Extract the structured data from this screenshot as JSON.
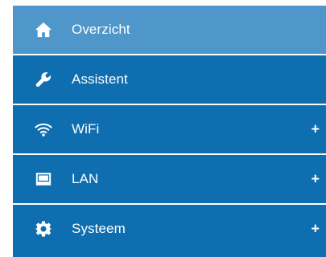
{
  "colors": {
    "item_bg": "#0f6eb0",
    "active_bg": "#4f96cb",
    "text": "#ffffff"
  },
  "menu": {
    "items": [
      {
        "label": "Overzicht",
        "icon": "home-icon",
        "active": true,
        "expandable": false
      },
      {
        "label": "Assistent",
        "icon": "wrench-icon",
        "active": false,
        "expandable": false
      },
      {
        "label": "WiFi",
        "icon": "wifi-icon",
        "active": false,
        "expandable": true,
        "expand_symbol": "+"
      },
      {
        "label": "LAN",
        "icon": "lan-icon",
        "active": false,
        "expandable": true,
        "expand_symbol": "+"
      },
      {
        "label": "Systeem",
        "icon": "gear-icon",
        "active": false,
        "expandable": true,
        "expand_symbol": "+"
      }
    ]
  }
}
